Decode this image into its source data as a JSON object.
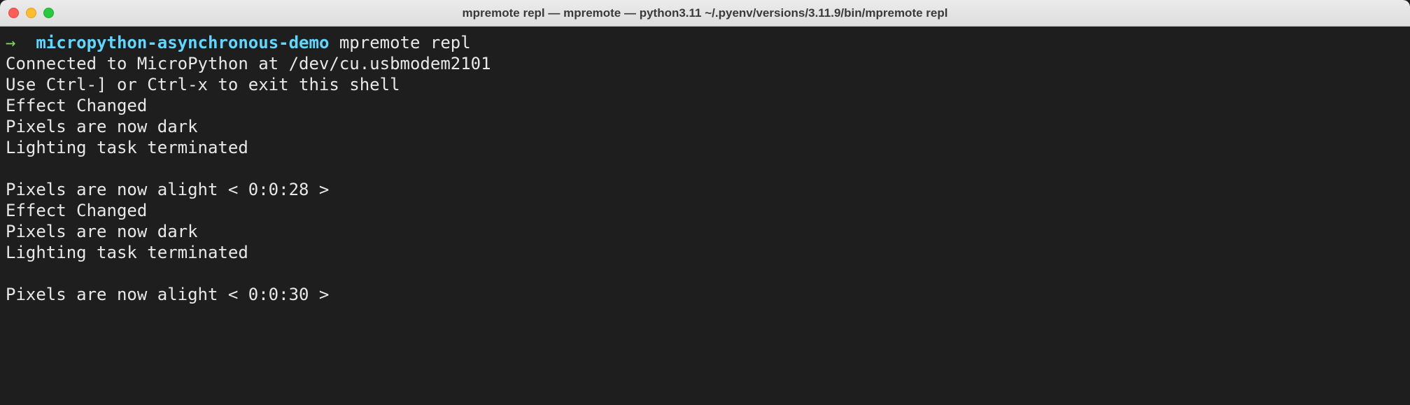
{
  "window": {
    "title": "mpremote repl — mpremote — python3.11 ~/.pyenv/versions/3.11.9/bin/mpremote repl"
  },
  "prompt": {
    "arrow": "→",
    "cwd": "micropython-asynchronous-demo",
    "command": "mpremote repl"
  },
  "output": {
    "lines": [
      "Connected to MicroPython at /dev/cu.usbmodem2101",
      "Use Ctrl-] or Ctrl-x to exit this shell",
      "Effect Changed",
      "Pixels are now dark",
      "Lighting task terminated",
      "",
      "Pixels are now alight < 0:0:28 >",
      "Effect Changed",
      "Pixels are now dark",
      "Lighting task terminated",
      "",
      "Pixels are now alight < 0:0:30 >"
    ]
  }
}
